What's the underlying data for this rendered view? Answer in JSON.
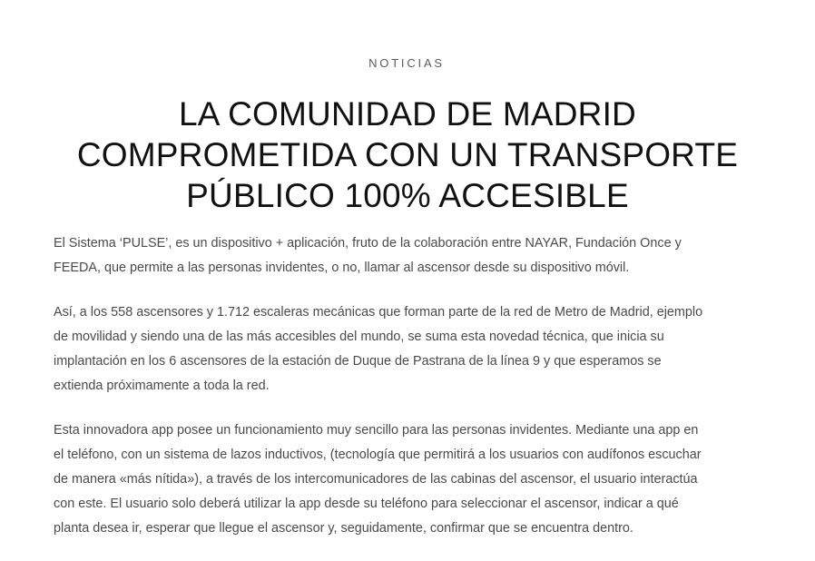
{
  "article": {
    "category": "NOTICIAS",
    "title_lines": [
      "LA COMUNIDAD DE MADRID",
      "COMPROMETIDA CON UN TRANSPORTE",
      "PÚBLICO 100% ACCESIBLE"
    ],
    "paragraphs": [
      [
        "El Sistema ‘PULSE’, es un dispositivo + aplicación, fruto de la colaboración entre NAYAR, Fundación Once y",
        "FEEDA, que permite a las personas invidentes, o no, llamar al ascensor desde su dispositivo móvil."
      ],
      [
        "Así, a los 558 ascensores y 1.712 escaleras mecánicas que forman parte de la red de Metro de Madrid, ejemplo",
        "de movilidad y siendo una de las más accesibles del mundo, se suma esta novedad técnica, que inicia su",
        "implantación en los 6 ascensores de la estación de Duque de Pastrana de la línea 9 y que esperamos se",
        "extienda próximamente a toda la red."
      ],
      [
        "Esta innovadora app posee un funcionamiento muy sencillo para las personas invidentes. Mediante una app en",
        "el teléfono, con un sistema de lazos inductivos, (tecnología que permitirá a los usuarios con audífonos escuchar",
        "de manera «más nítida»),  a través de los intercomunicadores de las cabinas del ascensor, el usuario interactúa",
        "con este. El usuario solo deberá utilizar la app desde su teléfono para seleccionar el ascensor, indicar a qué",
        "planta desea ir, esperar que llegue el ascensor y, seguidamente, confirmar que se encuentra dentro."
      ]
    ]
  }
}
